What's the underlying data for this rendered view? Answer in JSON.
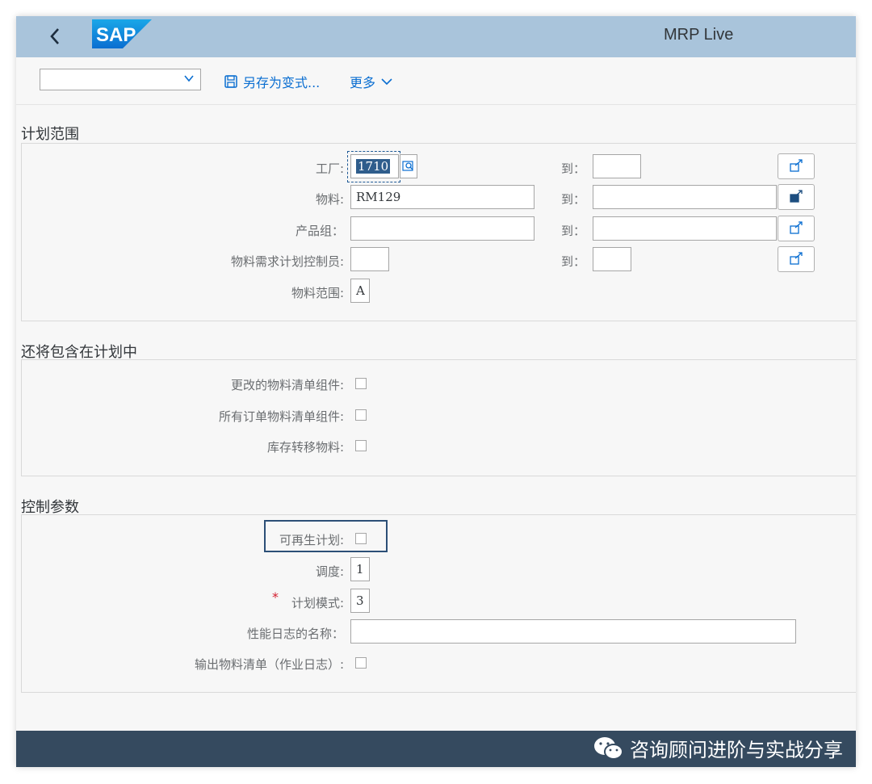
{
  "shell": {
    "app_title": "MRP Live",
    "logo_text": "SAP"
  },
  "toolbar": {
    "variant_value": "",
    "save_as_variant": "另存为变式...",
    "more": "更多"
  },
  "sections": {
    "planning_scope": {
      "title": "计划范围",
      "plant_label": "工厂:",
      "plant_value": "1710",
      "material_label": "物料:",
      "material_value": "RM129",
      "product_group_label": "产品组：",
      "product_group_value": "",
      "mrp_controller_label": "物料需求计划控制员:",
      "mrp_controller_value": "",
      "material_scope_label": "物料范围:",
      "material_scope_value": "A",
      "to_label": "到："
    },
    "also_include": {
      "title": "还将包含在计划中",
      "changed_bom_label": "更改的物料清单组件:",
      "all_order_bom_label": "所有订单物料清单组件:",
      "stock_transfer_label": "库存转移物料:"
    },
    "control_params": {
      "title": "控制参数",
      "regenerative_label": "可再生计划:",
      "scheduling_label": "调度:",
      "scheduling_value": "1",
      "planning_mode_label": "计划模式:",
      "planning_mode_value": "3",
      "required_mark": "*",
      "perf_log_label": "性能日志的名称：",
      "perf_log_value": "",
      "output_bom_label": "输出物料清单（作业日志）:"
    }
  },
  "footer": {
    "watermark": "咨询顾问进阶与实战分享"
  },
  "colors": {
    "shell": "#a9c4db",
    "footer": "#354a5f",
    "accent": "#0a6ed1",
    "highlight": "#2c4f77"
  }
}
